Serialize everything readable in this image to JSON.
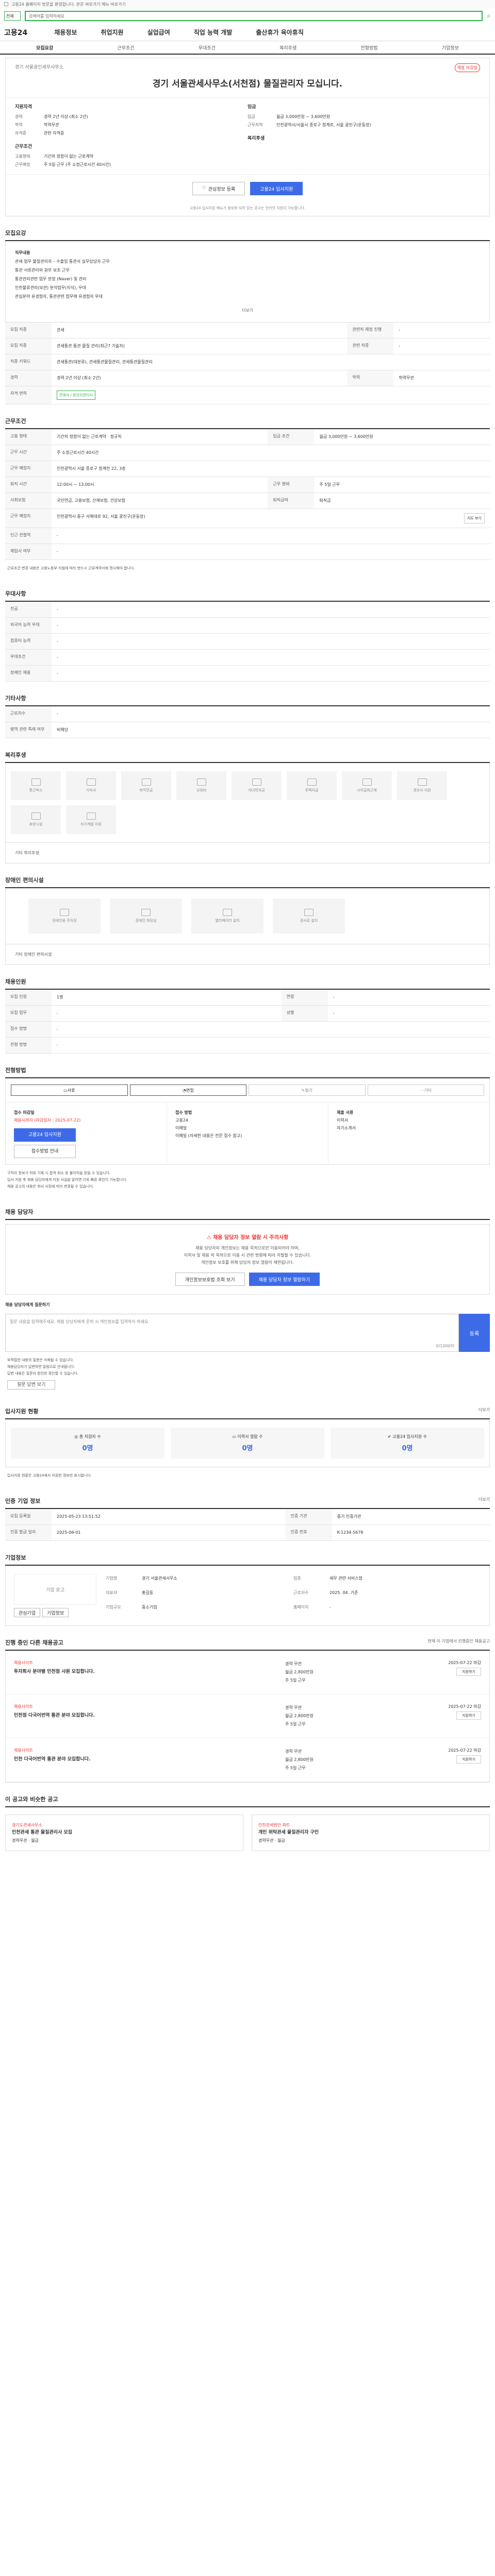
{
  "topbar": {
    "text": "고용24 홈페이지 방문을 환영합니다. 본문 바로가기 메뉴 바로가기"
  },
  "search": {
    "scope": "전체",
    "placeholder": "검색어를 입력하세요"
  },
  "gnb": {
    "logo": "고용24",
    "items": [
      "채용정보",
      "취업지원",
      "실업급여",
      "직업 능력 개발",
      "출산휴가 육아휴직"
    ]
  },
  "tabs": [
    "모집요강",
    "근무조건",
    "우대조건",
    "복리후생",
    "전형방법",
    "기업정보"
  ],
  "header": {
    "badge": "채용 마감일",
    "company_line": "경기 서울공인세무사무소",
    "title": "경기 서울관세사무소(서천점) 물질관리자 모십니다.",
    "left_title": "지원자격",
    "left": [
      {
        "k": "경력",
        "v": "경력 2년 이상 (최소 2년)"
      },
      {
        "k": "학력",
        "v": "학력무관"
      },
      {
        "k": "자격증",
        "v": "관련 자격증"
      }
    ],
    "left2_title": "근무조건",
    "left2": [
      {
        "k": "고용형태",
        "v": "기간의 정함이 없는 근로계약"
      },
      {
        "k": "근무예정",
        "v": "주 5일 근무 (주 소정근로시간 40시간)"
      }
    ],
    "right_title": "임금",
    "right": [
      {
        "k": "임금",
        "v": "월급 3,000만원 ~ 3,600만원"
      },
      {
        "k": "근무지역",
        "v": "인천광역시/서울시 종로구 청계로, 서울 광진구(운동장)"
      }
    ],
    "right2_title": "복리후생",
    "btn_interest": "관심정보 등록",
    "btn_apply": "고용24 입사지원",
    "note": "고용24 입사지원 메뉴가 활성화 되어 있는 공고는 인터넷 지원이 가능합니다."
  },
  "job": {
    "title": "모집요강",
    "desc_lines": [
      "직무내용",
      "관세 업무 물질관리자 – 수출입 통관서 실무담당자 근무",
      "통관 서류관리와 원부 보조 근무",
      "통관관리관련 업무 분장 (Naver) 및 관리",
      "인천물류관리(보관) 분석업무(지식), 우대",
      "관심분야 유경험자, 통관관련 업무에 유경험자 우대"
    ],
    "fold": "더보기",
    "rows": [
      {
        "k": "모집 직종",
        "v": "관세",
        "k2": "관련직 재정 진행",
        "v2": "-"
      },
      {
        "k": "모집 직종",
        "v": "관세통관 통관 물질 관리(최근7 기술자)",
        "k2": "관련 직종",
        "v2": "-"
      },
      {
        "k": "직종 키워드",
        "v": "관세통관(대분류), 관세통관물질관리, 관세통관물질관리",
        "k2": "",
        "v2": ""
      },
      {
        "k": "경력",
        "v": "경력 2년 이상 (최소 2년)",
        "k2": "학력",
        "v2": "학력무관"
      },
      {
        "k": "자격 면허",
        "v": "관세사 / 원산지관리사",
        "k2": "",
        "v2": ""
      }
    ]
  },
  "work": {
    "title": "근무조건",
    "rows": [
      {
        "k": "고용 형태",
        "v": "기간의 정함이 없는 근로계약 · 정규직",
        "k2": "임금 조건",
        "v2": "월급 3,000만원 ~ 3,600만원"
      },
      {
        "k": "근무 시간",
        "v": "주 소정근로시간 40시간",
        "k2": "",
        "v2": ""
      },
      {
        "k": "근무 예정지",
        "v": "인천광역시 서울 종로구 청계천 22, 3층",
        "k2": "",
        "v2": ""
      },
      {
        "k": "퇴직 시간",
        "v": "12:00시 ~ 13:00시",
        "k2": "근무 형태",
        "v2": "주 5일 근무"
      },
      {
        "k": "사회보험",
        "v": "국민연금, 고용보험, 산재보험, 건강보험",
        "k2": "퇴직급여",
        "v2": "퇴직금"
      },
      {
        "k": "근무 예정지",
        "v": "인천광역시 중구 서해대로 92, 서울 광진구(운동장)",
        "k2": "",
        "v2": ""
      },
      {
        "k": "인근 전철역",
        "v": "-",
        "k2": "",
        "v2": ""
      },
      {
        "k": "재입사 여부",
        "v": "-",
        "k2": "",
        "v2": ""
      }
    ],
    "note": "근로조건 변경 내용은 고용노동부 지침에 따라 반드시 근로계약서에 명시해야 합니다.",
    "map_btn": "지도 보기"
  },
  "pref": {
    "title": "우대사항",
    "rows": [
      {
        "k": "전공",
        "v": "-"
      },
      {
        "k": "외국어 능력 우대",
        "v": "-"
      },
      {
        "k": "컴퓨터 능력",
        "v": "-"
      },
      {
        "k": "우대조건",
        "v": "-"
      },
      {
        "k": "장애인 채용",
        "v": "-"
      }
    ]
  },
  "etc": {
    "title": "기타사항",
    "rows": [
      {
        "k": "근로자수",
        "v": "-"
      },
      {
        "k": "병역 관련 특례 여부",
        "v": "비해당"
      }
    ]
  },
  "welfare": {
    "title": "복리후생",
    "cards": [
      "통근버스",
      "기숙사",
      "퇴직연금",
      "교육비",
      "자녀학자금",
      "주택자금",
      "시차출퇴근제",
      "경조사 지원",
      "휴양시설",
      "자기계발 지원"
    ],
    "note": "기타 복리후생"
  },
  "welfare2": {
    "title": "장애인 편의시설",
    "cards": [
      "장애인용 주차장",
      "장애인 화장실",
      "엘리베이터 설치",
      "경사로 설치"
    ],
    "note": "기타 장애인 편의시설"
  },
  "wage": {
    "title": "채용인원",
    "rows": [
      {
        "k": "모집 인원",
        "v": "1명",
        "k2": "연령",
        "v2": "-"
      },
      {
        "k": "모집 업무",
        "v": "-",
        "k2": "성별",
        "v2": "-"
      },
      {
        "k": "접수 방법",
        "v": "-",
        "k2": "",
        "v2": ""
      },
      {
        "k": "전형 방법",
        "v": "-",
        "k2": "",
        "v2": ""
      }
    ]
  },
  "apply": {
    "title": "전형방법",
    "tabs": [
      "서류",
      "면접",
      "필기",
      "기타"
    ],
    "left_title": "접수 마감일",
    "left_red": "채용시까지 (마감일자 : 2025-07-22)",
    "btn_apply": "고용24 입사지원",
    "btn_email": "접수방법 안내",
    "mid_title": "접수 방법",
    "mid_lines": [
      "고용24",
      "이메일",
      "이메일 (자세한 내용은 전문 접수 참고)"
    ],
    "right_title": "제출 서류",
    "right_lines": [
      "이력서",
      "자기소개서"
    ],
    "notes": [
      "구직자 정보가 허위 기재 시 합격 취소 등 불이익을 받을 수 있습니다.",
      "입사 지원 후 채용 담당자에게 지원 사실을 알리면 더욱 빠른 확인이 가능합니다.",
      "채용 공고의 내용은 회사 사정에 따라 변경될 수 있습니다."
    ]
  },
  "contact": {
    "title": "채용 담당자",
    "danger_title": "채용 담당자 정보 열람 시 주의사항",
    "danger_lines": [
      "채용 담당자의 개인정보는 채용 목적으로만 이용되어야 하며,",
      "이력서 및 채용 외 목적으로 이용 시 관련 법령에 따라 처벌될 수 있습니다.",
      "개인정보 보호를 위해 담당자 정보 열람이 제한됩니다."
    ],
    "btn1": "개인정보보호법 조회 보기",
    "btn2": "채용 담당자 정보 열람하기",
    "qa_label": "채용 담당자에게 질문하기",
    "qa_placeholder": "질문 내용을 입력해주세요. 채용 담당자에게 문의 시 개인정보를 입력하지 마세요.",
    "qa_count": "0/1000자",
    "qa_send": "등록",
    "qa_notes": [
      "부적절한 내용의 질문은 삭제될 수 있습니다.",
      "채용담당자가 답변하면 알림으로 안내됩니다.",
      "답변 내용은 질문자 본인만 확인할 수 있습니다."
    ],
    "qa_btn": "질문 답변 보기"
  },
  "stats": {
    "title": "입사지원 현황",
    "more": "더보기",
    "items": [
      {
        "label": "총 지원자 수",
        "value": "0명"
      },
      {
        "label": "이력서 열람 수",
        "value": "0명"
      },
      {
        "label": "고용24 입사지원 수",
        "value": "0명"
      }
    ],
    "note": "입사지원 현황은 고용24에서 지원한 정보만 표시됩니다."
  },
  "regist": {
    "title": "인증 기업 정보",
    "more": "더보기",
    "rows": [
      {
        "k": "모집 등록일",
        "v": "2025-05-23 13:51:52",
        "k2": "인증 기관",
        "v2": "중기 인증기관"
      },
      {
        "k": "인증 발급 일자",
        "v": "2025-06-01",
        "k2": "인증 번호",
        "v2": "K-1234-5678"
      }
    ]
  },
  "companyinfo": {
    "title": "기업정보",
    "logo": "기업 로고",
    "btn1": "관심기업",
    "btn2": "기업정보",
    "info": [
      {
        "k": "기업명",
        "v": "경기 서울관세사무소"
      },
      {
        "k": "업종",
        "v": "세무 관련 서비스업"
      },
      {
        "k": "대표자",
        "v": "홍길동"
      },
      {
        "k": "근로자수",
        "v": "2025. 04. 기준"
      },
      {
        "k": "기업규모",
        "v": "중소기업"
      },
      {
        "k": "홈페이지",
        "v": "-"
      }
    ]
  },
  "ongoing": {
    "title": "진행 중인 다른 채용공고",
    "more": "현재 이 기업에서 진행중인 채용공고",
    "items": [
      {
        "company": "채용사이트",
        "title": "투자회사 분야별 인천점 사원 모집합니다.",
        "info": [
          "경력 무관",
          "월급 2,800만원",
          "주 5일 근무"
        ],
        "date": "2025-07-22 마감",
        "btn": "지원하기"
      },
      {
        "company": "채용사이트",
        "title": "인천점 다국어번역 통관 분야 모집합니다.",
        "info": [
          "경력 무관",
          "월급 2,800만원",
          "주 5일 근무"
        ],
        "date": "2025-07-22 마감",
        "btn": "지원하기"
      },
      {
        "company": "채용사이트",
        "title": "인천 다국어번역 통관 분야 모집합니다.",
        "info": [
          "경력 무관",
          "월급 2,800만원",
          "주 5일 근무"
        ],
        "date": "2025-07-22 마감",
        "btn": "지원하기"
      }
    ]
  },
  "similar": {
    "title": "이 공고와 비슷한 공고",
    "items": [
      {
        "company": "경기도관세사무소",
        "title": "인천관세 통관 물질관리사 모집",
        "info": "경력무관 · 월급"
      },
      {
        "company": "인천관세법인 파트",
        "title": "개인 위탁관세 물질관리자 구인",
        "info": "경력무관 · 월급"
      }
    ]
  }
}
